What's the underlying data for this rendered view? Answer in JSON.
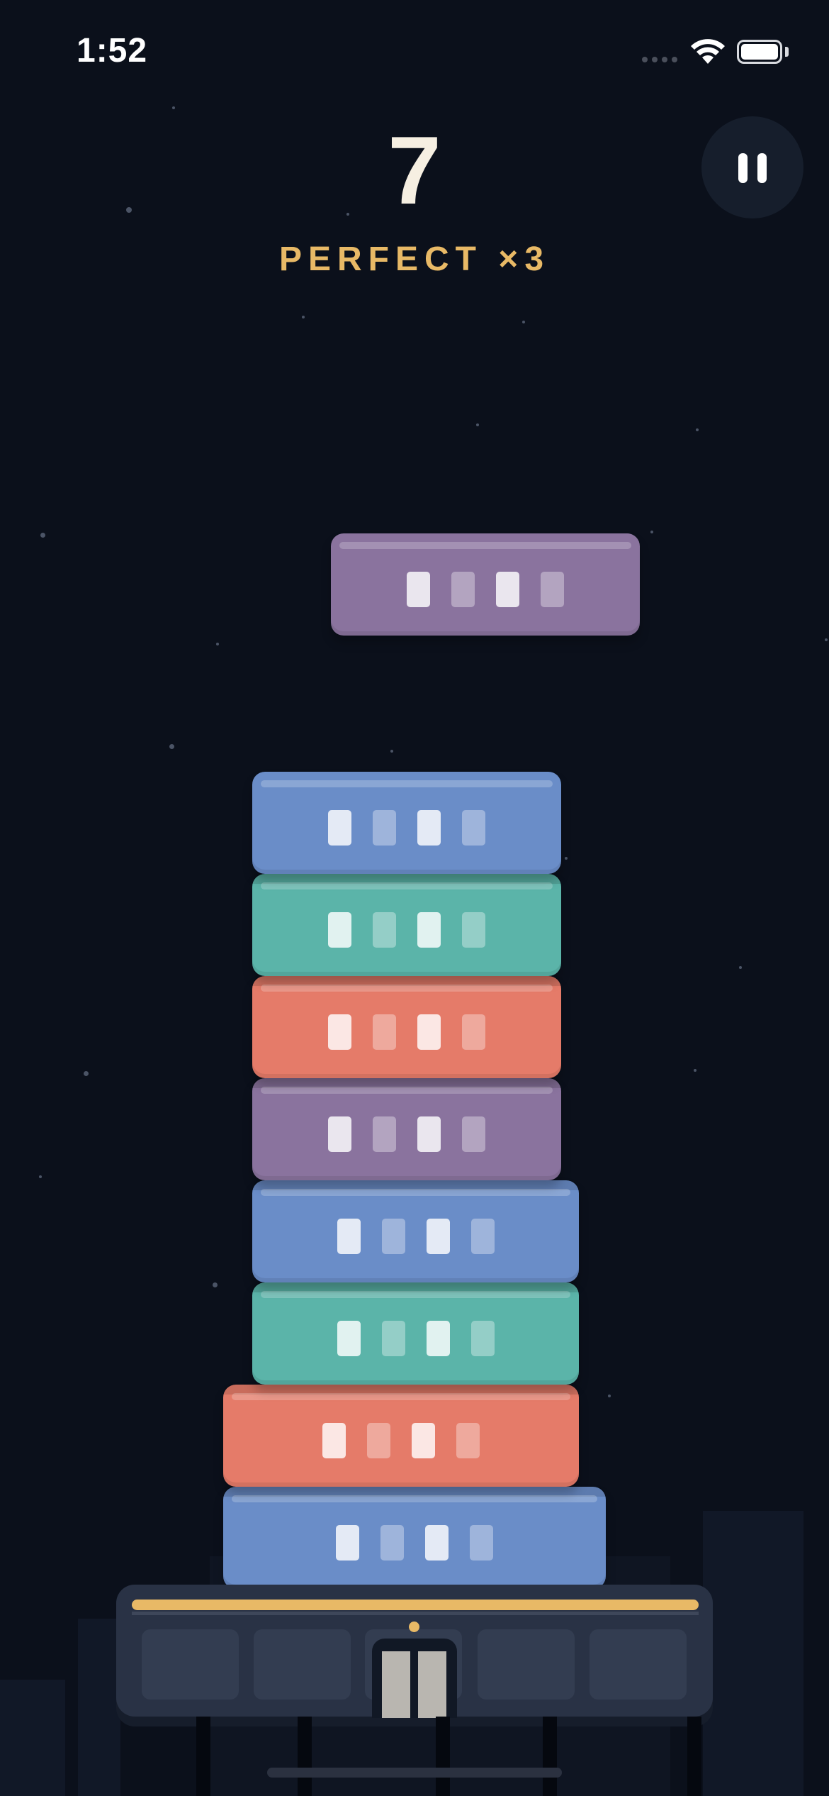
{
  "status_bar": {
    "time": "1:52",
    "wifi_icon": "wifi-icon",
    "battery_icon": "battery-icon",
    "battery_level": 1.0
  },
  "hud": {
    "score": "7",
    "combo": "PERFECT ×3",
    "pause_icon": "pause-icon"
  },
  "colors": {
    "background": "#0b101b",
    "blue": "#6a8dc8",
    "teal": "#5bb4a9",
    "coral": "#e57b69",
    "purple": "#8a739e",
    "accent": "#e8b966"
  },
  "swinging_block": {
    "color": "purple"
  },
  "tower": {
    "floors_bottom_to_top": [
      "blue",
      "coral",
      "teal",
      "blue",
      "purple",
      "coral",
      "teal",
      "blue"
    ],
    "floor_count": 8
  }
}
